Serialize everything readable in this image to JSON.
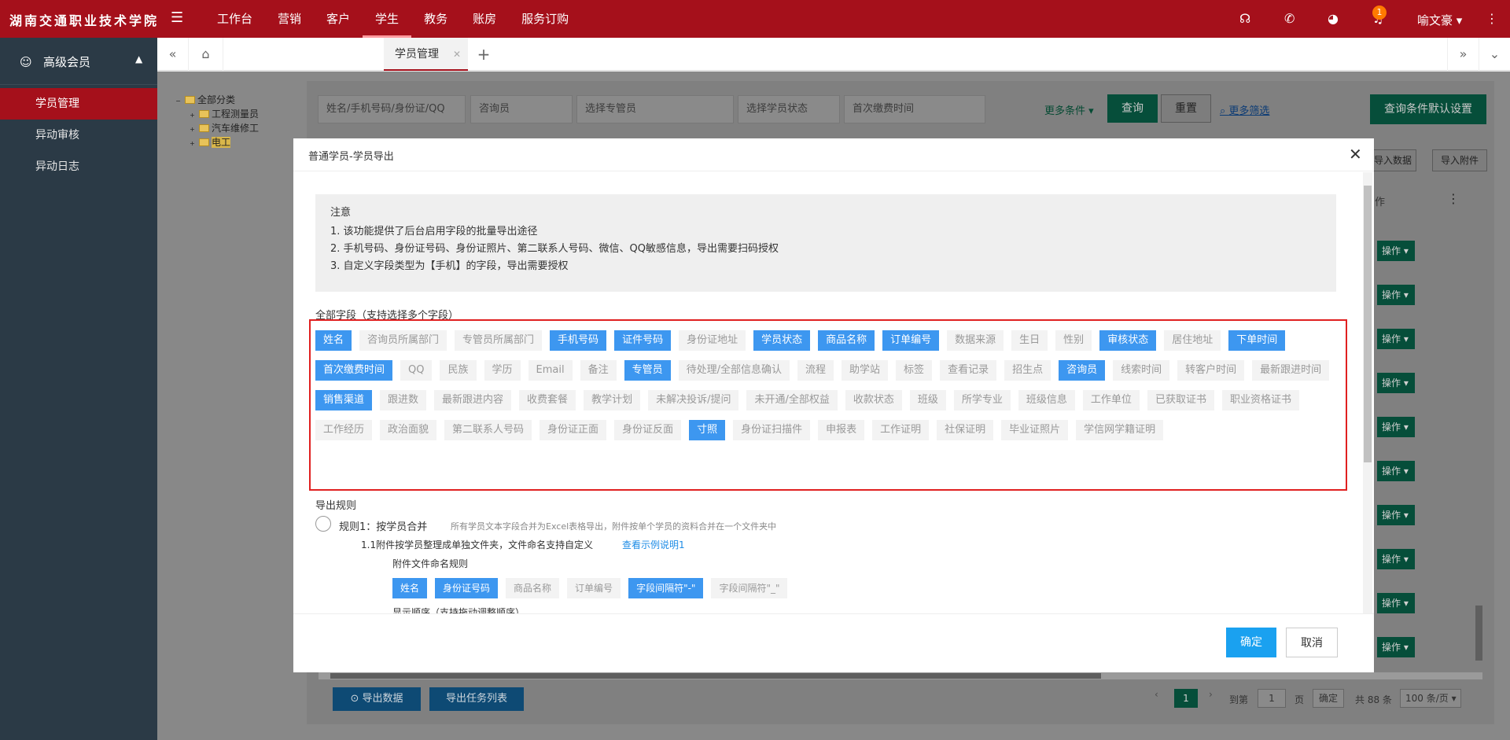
{
  "header": {
    "logo": "湖南交通职业技术学院",
    "nav": [
      "工作台",
      "营销",
      "客户",
      "学生",
      "教务",
      "账房",
      "服务订购"
    ],
    "active_nav": "学生",
    "notify_count": "1",
    "user": "喻文豪"
  },
  "sidebar": {
    "title": "高级会员",
    "items": [
      "学员管理",
      "异动审核",
      "异动日志"
    ]
  },
  "tabs": {
    "active": "学员管理"
  },
  "tree": {
    "root": "全部分类",
    "children": [
      "工程测量员",
      "汽车维修工",
      "电工"
    ]
  },
  "filters": {
    "search_placeholder": "姓名/手机号码/身份证/QQ",
    "counselor": "咨询员",
    "manager": "选择专管员",
    "status": "选择学员状态",
    "first_pay": "首次缴费时间",
    "more": "更多条件",
    "query": "查询",
    "reset": "重置",
    "more_filter": "更多筛选",
    "default_setting": "查询条件默认设置",
    "import_data": "导入数据",
    "import_attach": "导入附件",
    "op_col": "作",
    "op": "操作"
  },
  "modal": {
    "title": "普通学员-学员导出",
    "notice_title": "注意",
    "notice_lines": [
      "1. 该功能提供了后台启用字段的批量导出途径",
      "2. 手机号码、身份证号码、身份证照片、第二联系人号码、微信、QQ敏感信息，导出需要扫码授权",
      "3. 自定义字段类型为【手机】的字段，导出需要授权"
    ],
    "all_fields_label": "全部字段（支持选择多个字段）",
    "fields": [
      {
        "label": "姓名",
        "sel": true
      },
      {
        "label": "咨询员所属部门",
        "sel": false
      },
      {
        "label": "专管员所属部门",
        "sel": false
      },
      {
        "label": "手机号码",
        "sel": true
      },
      {
        "label": "证件号码",
        "sel": true
      },
      {
        "label": "身份证地址",
        "sel": false
      },
      {
        "label": "学员状态",
        "sel": true
      },
      {
        "label": "商品名称",
        "sel": true
      },
      {
        "label": "订单编号",
        "sel": true
      },
      {
        "label": "数据来源",
        "sel": false
      },
      {
        "label": "生日",
        "sel": false
      },
      {
        "label": "性别",
        "sel": false
      },
      {
        "label": "审核状态",
        "sel": true
      },
      {
        "label": "居住地址",
        "sel": false
      },
      {
        "label": "下单时间",
        "sel": true
      },
      {
        "label": "首次缴费时间",
        "sel": true
      },
      {
        "label": "QQ",
        "sel": false
      },
      {
        "label": "民族",
        "sel": false
      },
      {
        "label": "学历",
        "sel": false
      },
      {
        "label": "Email",
        "sel": false
      },
      {
        "label": "备注",
        "sel": false
      },
      {
        "label": "专管员",
        "sel": true
      },
      {
        "label": "待处理/全部信息确认",
        "sel": false
      },
      {
        "label": "流程",
        "sel": false
      },
      {
        "label": "助学站",
        "sel": false
      },
      {
        "label": "标签",
        "sel": false
      },
      {
        "label": "查看记录",
        "sel": false
      },
      {
        "label": "招生点",
        "sel": false
      },
      {
        "label": "咨询员",
        "sel": true
      },
      {
        "label": "线索时间",
        "sel": false
      },
      {
        "label": "转客户时间",
        "sel": false
      },
      {
        "label": "最新跟进时间",
        "sel": false
      },
      {
        "label": "销售渠道",
        "sel": true
      },
      {
        "label": "跟进数",
        "sel": false
      },
      {
        "label": "最新跟进内容",
        "sel": false
      },
      {
        "label": "收费套餐",
        "sel": false
      },
      {
        "label": "教学计划",
        "sel": false
      },
      {
        "label": "未解决投诉/提问",
        "sel": false
      },
      {
        "label": "未开通/全部权益",
        "sel": false
      },
      {
        "label": "收款状态",
        "sel": false
      },
      {
        "label": "班级",
        "sel": false
      },
      {
        "label": "所学专业",
        "sel": false
      },
      {
        "label": "班级信息",
        "sel": false
      },
      {
        "label": "工作单位",
        "sel": false
      },
      {
        "label": "已获取证书",
        "sel": false
      },
      {
        "label": "职业资格证书",
        "sel": false
      },
      {
        "label": "工作经历",
        "sel": false
      },
      {
        "label": "政治面貌",
        "sel": false
      },
      {
        "label": "第二联系人号码",
        "sel": false
      },
      {
        "label": "身份证正面",
        "sel": false
      },
      {
        "label": "身份证反面",
        "sel": false
      },
      {
        "label": "寸照",
        "sel": true
      },
      {
        "label": "身份证扫描件",
        "sel": false
      },
      {
        "label": "申报表",
        "sel": false
      },
      {
        "label": "工作证明",
        "sel": false
      },
      {
        "label": "社保证明",
        "sel": false
      },
      {
        "label": "毕业证照片",
        "sel": false
      },
      {
        "label": "学信网学籍证明",
        "sel": false
      }
    ],
    "export_rule_label": "导出规则",
    "rule1_title": "规则1：按学员合并",
    "rule1_desc": "所有学员文本字段合并为Excel表格导出，附件按单个学员的资料合并在一个文件夹中",
    "rule11": "1.1附件按学员整理成单独文件夹，文件命名支持自定义",
    "rule11_link": "查看示例说明1",
    "naming_label": "附件文件命名规则",
    "naming_tags": [
      {
        "label": "姓名",
        "sel": true
      },
      {
        "label": "身份证号码",
        "sel": true
      },
      {
        "label": "商品名称",
        "sel": false
      },
      {
        "label": "订单编号",
        "sel": false
      },
      {
        "label": "字段间隔符\"-\"",
        "sel": true
      },
      {
        "label": "字段间隔符\"_\"",
        "sel": false
      }
    ],
    "order_label": "显示顺序（支持拖动调整顺序）",
    "ok": "确定",
    "cancel": "取消"
  },
  "bottom": {
    "export": "导出数据",
    "tasks": "导出任务列表",
    "page": "1",
    "goto": "到第",
    "goto_val": "1",
    "page_unit": "页",
    "confirm": "确定",
    "total": "共 88 条",
    "per_page": "100 条/页"
  }
}
